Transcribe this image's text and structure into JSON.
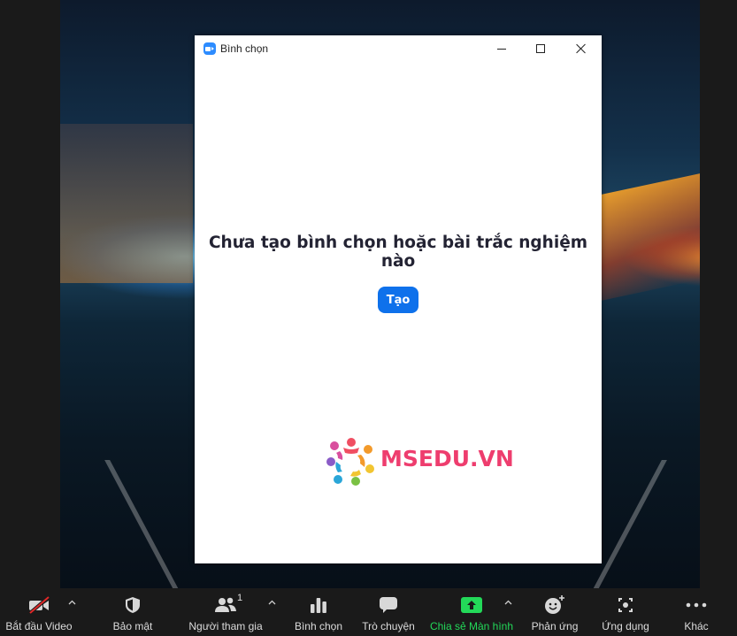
{
  "poll_window": {
    "title": "Bình chọn",
    "empty_message": "Chưa tạo bình chọn hoặc bài trắc nghiệm nào",
    "create_button": "Tạo"
  },
  "watermark": {
    "text": "MSEDU.VN",
    "color": "#ee3d6e"
  },
  "toolbar": {
    "start_video": "Bắt đầu Video",
    "security": "Bảo mật",
    "participants": "Người tham gia",
    "participants_count": "1",
    "polls": "Bình chọn",
    "chat": "Trò chuyện",
    "share_screen": "Chia sẻ Màn hình",
    "reactions": "Phản ứng",
    "apps": "Ứng dụng",
    "more": "Khác",
    "share_color": "#23d959",
    "accent_color": "#0e71eb"
  },
  "icons": [
    "zoom-app-icon",
    "video-off-icon",
    "shield-icon",
    "participants-icon",
    "poll-bar-chart-icon",
    "chat-bubble-icon",
    "share-screen-icon",
    "reaction-smiley-icon",
    "apps-icon",
    "more-dots-icon"
  ]
}
